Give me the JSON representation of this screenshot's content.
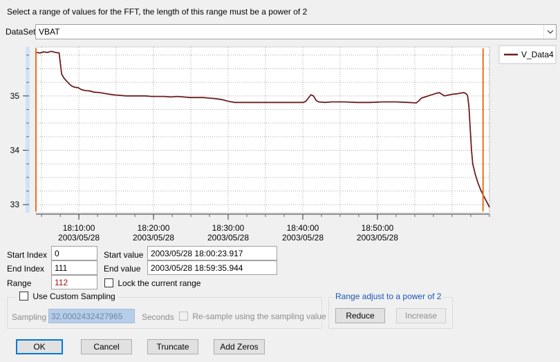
{
  "instruction": "Select a range of values for the FFT, the length of this range must be a power of 2",
  "dataset": {
    "label": "DataSet",
    "value": "VBAT"
  },
  "chart_data": {
    "type": "line",
    "series": [
      {
        "name": "V_Data4",
        "color": "#6b1f1f",
        "values": [
          [
            0,
            35.8
          ],
          [
            3,
            35.79
          ],
          [
            6,
            35.81
          ],
          [
            9,
            35.8
          ],
          [
            12,
            35.82
          ],
          [
            15,
            35.8
          ],
          [
            18,
            35.79
          ],
          [
            19,
            35.6
          ],
          [
            20,
            35.4
          ],
          [
            22,
            35.32
          ],
          [
            24,
            35.27
          ],
          [
            26,
            35.22
          ],
          [
            28,
            35.18
          ],
          [
            30,
            35.16
          ],
          [
            33,
            35.15
          ],
          [
            35,
            35.12
          ],
          [
            38,
            35.1
          ],
          [
            42,
            35.09
          ],
          [
            45,
            35.07
          ],
          [
            50,
            35.06
          ],
          [
            55,
            35.04
          ],
          [
            60,
            35.02
          ],
          [
            65,
            35.01
          ],
          [
            70,
            35.0
          ],
          [
            75,
            35.0
          ],
          [
            80,
            35.0
          ],
          [
            85,
            35.0
          ],
          [
            90,
            34.99
          ],
          [
            95,
            34.99
          ],
          [
            100,
            34.99
          ],
          [
            105,
            34.98
          ],
          [
            110,
            34.99
          ],
          [
            115,
            34.98
          ],
          [
            120,
            34.97
          ],
          [
            125,
            34.97
          ],
          [
            130,
            34.97
          ],
          [
            135,
            34.96
          ],
          [
            140,
            34.95
          ],
          [
            145,
            34.93
          ],
          [
            150,
            34.9
          ],
          [
            155,
            34.88
          ],
          [
            160,
            34.88
          ],
          [
            170,
            34.88
          ],
          [
            180,
            34.88
          ],
          [
            190,
            34.88
          ],
          [
            200,
            34.88
          ],
          [
            208,
            34.88
          ],
          [
            210,
            34.9
          ],
          [
            212,
            34.96
          ],
          [
            214,
            35.02
          ],
          [
            216,
            35.0
          ],
          [
            218,
            34.92
          ],
          [
            220,
            34.89
          ],
          [
            225,
            34.88
          ],
          [
            230,
            34.89
          ],
          [
            240,
            34.89
          ],
          [
            250,
            34.88
          ],
          [
            260,
            34.88
          ],
          [
            270,
            34.89
          ],
          [
            280,
            34.89
          ],
          [
            290,
            34.88
          ],
          [
            296,
            34.87
          ],
          [
            298,
            34.91
          ],
          [
            300,
            34.96
          ],
          [
            304,
            34.99
          ],
          [
            308,
            35.02
          ],
          [
            312,
            35.05
          ],
          [
            314,
            35.06
          ],
          [
            316,
            35.03
          ],
          [
            318,
            35.0
          ],
          [
            320,
            35.01
          ],
          [
            324,
            35.03
          ],
          [
            328,
            35.04
          ],
          [
            330,
            35.05
          ],
          [
            333,
            35.06
          ],
          [
            335,
            35.04
          ],
          [
            336,
            35.0
          ],
          [
            337,
            34.8
          ],
          [
            338,
            34.4
          ],
          [
            339,
            34.0
          ],
          [
            340,
            33.75
          ],
          [
            342,
            33.55
          ],
          [
            344,
            33.4
          ],
          [
            346,
            33.28
          ],
          [
            348,
            33.18
          ],
          [
            350,
            33.09
          ],
          [
            352,
            33.0
          ],
          [
            353,
            32.95
          ]
        ]
      }
    ],
    "x_ticks": [
      {
        "t": 33.4,
        "time": "18:10:00",
        "date": "2003/05/28"
      },
      {
        "t": 91.5,
        "time": "18:20:00",
        "date": "2003/05/28"
      },
      {
        "t": 149.6,
        "time": "18:30:00",
        "date": "2003/05/28"
      },
      {
        "t": 207.7,
        "time": "18:40:00",
        "date": "2003/05/28"
      },
      {
        "t": 265.8,
        "time": "18:50:00",
        "date": "2003/05/28"
      }
    ],
    "y_ticks": [
      33,
      34,
      35
    ],
    "xlim": [
      0,
      353
    ],
    "ylim": [
      32.85,
      35.9
    ],
    "grid": true,
    "legend": "right",
    "range_markers": [
      0,
      348
    ]
  },
  "fields": {
    "start_index_label": "Start Index",
    "start_index_value": "0",
    "end_index_label": "End Index",
    "end_index_value": "111",
    "range_label": "Range",
    "range_value": "112",
    "start_value_label": "Start value",
    "start_value_value": "2003/05/28 18:00:23.917",
    "end_value_label": "End value",
    "end_value_value": "2003/05/28 18:59:35.944",
    "lock_label": "Lock the current range"
  },
  "sampling": {
    "group_label": "Use Custom Sampling",
    "sampling_label": "Sampling",
    "sampling_value": "32.0002432427965",
    "seconds_label": "Seconds",
    "resample_label": "Re-sample using the sampling value"
  },
  "range_adjust": {
    "title": "Range adjust to a power of 2",
    "reduce": "Reduce",
    "increase": "Increase"
  },
  "buttons": {
    "ok": "OK",
    "cancel": "Cancel",
    "truncate": "Truncate",
    "add_zeros": "Add Zeros"
  }
}
